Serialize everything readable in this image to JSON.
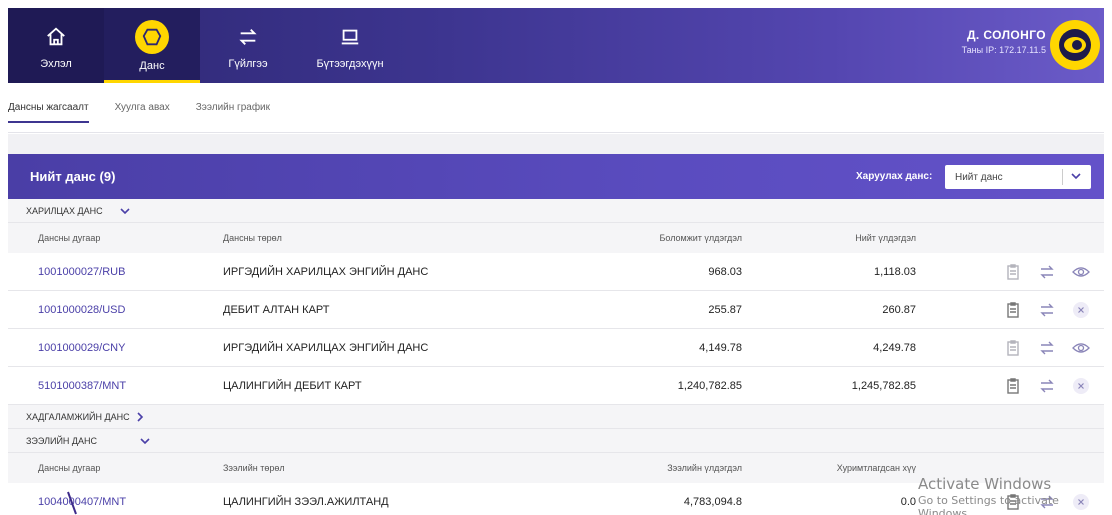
{
  "nav": {
    "items": [
      {
        "label": "Эхлэл",
        "icon": "home-icon"
      },
      {
        "label": "Данс",
        "icon": "piggy-bank-icon"
      },
      {
        "label": "Гүйлгээ",
        "icon": "transfer-icon"
      },
      {
        "label": "Бүтээгдэхүүн",
        "icon": "laptop-icon"
      }
    ],
    "active": "Данс"
  },
  "user": {
    "name": "Д. СОЛОНГО",
    "ip": "Таны IP: 172.17.11.5"
  },
  "subtabs": [
    "Дансны жагсаалт",
    "Хуулга авах",
    "Зээлийн график"
  ],
  "accounts": {
    "title": "Нийт данс (9)",
    "filter_label": "Харуулах данс:",
    "filter_value": "Нийт данс"
  },
  "current": {
    "section": "ХАРИЛЦАХ ДАНС",
    "headers": {
      "number": "Дансны дугаар",
      "type": "Дансны төрөл",
      "available": "Боломжит үлдэгдэл",
      "total": "Нийт үлдэгдэл"
    },
    "rows": [
      {
        "number": "1001000027/RUB",
        "type": "ИРГЭДИЙН ХАРИЛЦАХ ЭНГИЙН ДАНС",
        "available": "968.03",
        "total": "1,118.03",
        "last_icon": "eye-icon"
      },
      {
        "number": "1001000028/USD",
        "type": "ДЕБИТ АЛТАН КАРТ",
        "available": "255.87",
        "total": "260.87",
        "last_icon": "close-icon"
      },
      {
        "number": "1001000029/CNY",
        "type": "ИРГЭДИЙН ХАРИЛЦАХ ЭНГИЙН ДАНС",
        "available": "4,149.78",
        "total": "4,249.78",
        "last_icon": "eye-icon"
      },
      {
        "number": "5101000387/MNT",
        "type": "ЦАЛИНГИЙН ДЕБИТ КАРТ",
        "available": "1,240,782.85",
        "total": "1,245,782.85",
        "last_icon": "close-icon"
      }
    ]
  },
  "savings": {
    "section": "ХАДГАЛАМЖИЙН ДАНС"
  },
  "loan": {
    "section": "ЗЭЭЛИЙН ДАНС",
    "headers": {
      "number": "Дансны дугаар",
      "type": "Зээлийн төрөл",
      "balance": "Зээлийн үлдэгдэл",
      "interest": "Хуримтлагдсан хүү"
    },
    "rows": [
      {
        "number": "1004000407/MNT",
        "type": "ЦАЛИНГИЙН ЗЭЭЛ.АЖИЛТАНД",
        "balance": "4,783,094.8",
        "interest": "0.0"
      }
    ]
  },
  "watermark": {
    "line1": "Activate Windows",
    "line2": "Go to Settings to activate Windows."
  },
  "colors": {
    "primary": "#3d3590",
    "accent": "#ffd600",
    "link": "#4b40a8"
  }
}
